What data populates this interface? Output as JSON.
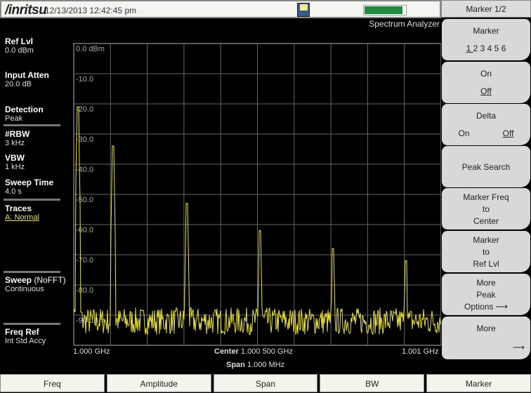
{
  "header": {
    "brand": "/inritsu",
    "datetime": "12/13/2013 12:42:45 pm",
    "battery_level_pct": 90,
    "mode": "Spectrum Analyzer"
  },
  "sidebar": [
    {
      "label": "Ref Lvl",
      "value": "0.0 dBm"
    },
    {
      "label": "Input Atten",
      "value": "20.0 dB"
    },
    {
      "label": "Detection",
      "value": "Peak"
    },
    {
      "label": "#RBW",
      "value": "3 kHz"
    },
    {
      "label": "VBW",
      "value": "1 kHz"
    },
    {
      "label": "Sweep Time",
      "value": "4.0 s"
    },
    {
      "label": "Traces",
      "value": "A: Normal"
    },
    {
      "label": "Sweep",
      "label_extra": "(NoFFT)",
      "value": "Continuous"
    },
    {
      "label": "Freq Ref",
      "value": "Int Std Accy"
    }
  ],
  "chart_data": {
    "type": "line",
    "ylim": [
      -100,
      0
    ],
    "y_tick_labels": [
      "0.0 dBm",
      "-10.0",
      "-20.0",
      "-30.0",
      "-40.0",
      "-50.0",
      "-60.0",
      "-70.0",
      "-80.0",
      "-90 dBm"
    ],
    "xlim_ghz": [
      1.0,
      1.001
    ],
    "x_start_label": "1.000 GHz",
    "x_end_label": "1.001 GHz",
    "center_label": "Center",
    "center_value": "1.000 500 GHz",
    "span_label": "Span",
    "span_value": "1.000 MHz",
    "grid": true,
    "trace_color": "#e8e040",
    "noise_floor_dbm": -92,
    "peaks": [
      {
        "freq_ghz": 1.000011,
        "dbm": -21
      },
      {
        "freq_ghz": 1.000107,
        "dbm": -34
      },
      {
        "freq_ghz": 1.000308,
        "dbm": -53
      },
      {
        "freq_ghz": 1.000507,
        "dbm": -62
      },
      {
        "freq_ghz": 1.000706,
        "dbm": -68
      },
      {
        "freq_ghz": 1.000904,
        "dbm": -72
      }
    ]
  },
  "panel": {
    "title": "Marker 1/2",
    "marker": {
      "label": "Marker",
      "options": [
        "1",
        "2",
        "3",
        "4",
        "5",
        "6"
      ],
      "selected": "1"
    },
    "onoff": {
      "on": "On",
      "off": "Off"
    },
    "delta": {
      "label": "Delta",
      "on": "On",
      "off": "Off"
    },
    "peak_search": "Peak Search",
    "freq_to_center": [
      "Marker Freq",
      "to",
      "Center"
    ],
    "to_ref": [
      "Marker",
      "to",
      "Ref Lvl"
    ],
    "more_peak": [
      "More",
      "Peak",
      "Options"
    ],
    "more": "More"
  },
  "tabs": [
    "Freq",
    "Amplitude",
    "Span",
    "BW",
    "Marker"
  ]
}
